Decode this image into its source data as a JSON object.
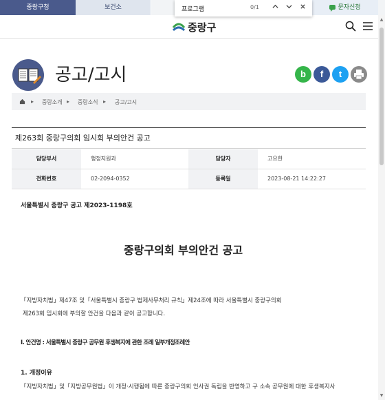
{
  "tabs": [
    {
      "label": "중랑구청",
      "active": true
    },
    {
      "label": "보건소",
      "active": false
    },
    {
      "label": "문자신청",
      "active": false
    }
  ],
  "find_bar": {
    "query": "프로그램",
    "count": "0/1"
  },
  "logo": {
    "text": "중랑구"
  },
  "page": {
    "title": "공고/고시"
  },
  "social": [
    {
      "name": "blog-icon",
      "glyph": "b",
      "color": "#35b54a"
    },
    {
      "name": "facebook-icon",
      "glyph": "f",
      "color": "#3b5998"
    },
    {
      "name": "twitter-icon",
      "glyph": "t",
      "color": "#1da1f2"
    },
    {
      "name": "print-icon",
      "glyph": "",
      "color": "#8a8a8a"
    }
  ],
  "breadcrumb": {
    "level1": "중랑소개",
    "level2": "중랑소식",
    "level3": "공고/고시"
  },
  "article": {
    "title": "제263회 중랑구의회 임시회 부의안건 공고",
    "meta": {
      "dept_label": "담당부서",
      "dept_value": "행정지원과",
      "manager_label": "담당자",
      "manager_value": "고요한",
      "phone_label": "전화번호",
      "phone_value": "02-2094-0352",
      "date_label": "등록일",
      "date_value": "2023-08-21 14:22:27"
    }
  },
  "body": {
    "doc_no": "서울특별시 중랑구 공고 제2023-1198호",
    "doc_title": "중랑구의회 부의안건 공고",
    "para1_line1": "「지방자치법」제47조 및「서울특별시 중랑구 법제사무처리 규칙」제24조에 따라 서울특별시 중랑구의회",
    "para1_line2": "제263회 임시회에 부의할 안건을 다음과 같이 공고합니다.",
    "item1": "Ⅰ. 안건명 : 서울특별시 중랑구 공무원 후생복지에 관한 조례 일부개정조례안",
    "section1": "1. 개정이유",
    "reason_line": "「지방자치법」및「지방공무원법」이 개정·시행됨에 따른 중랑구의회 인사권 독립을 반영하고 구 소속 공무원에 대한 후생복지사"
  },
  "colors": {
    "brand": "#4a5a8c",
    "logo_green": "#3aa14b",
    "logo_blue": "#2b6cb0"
  }
}
